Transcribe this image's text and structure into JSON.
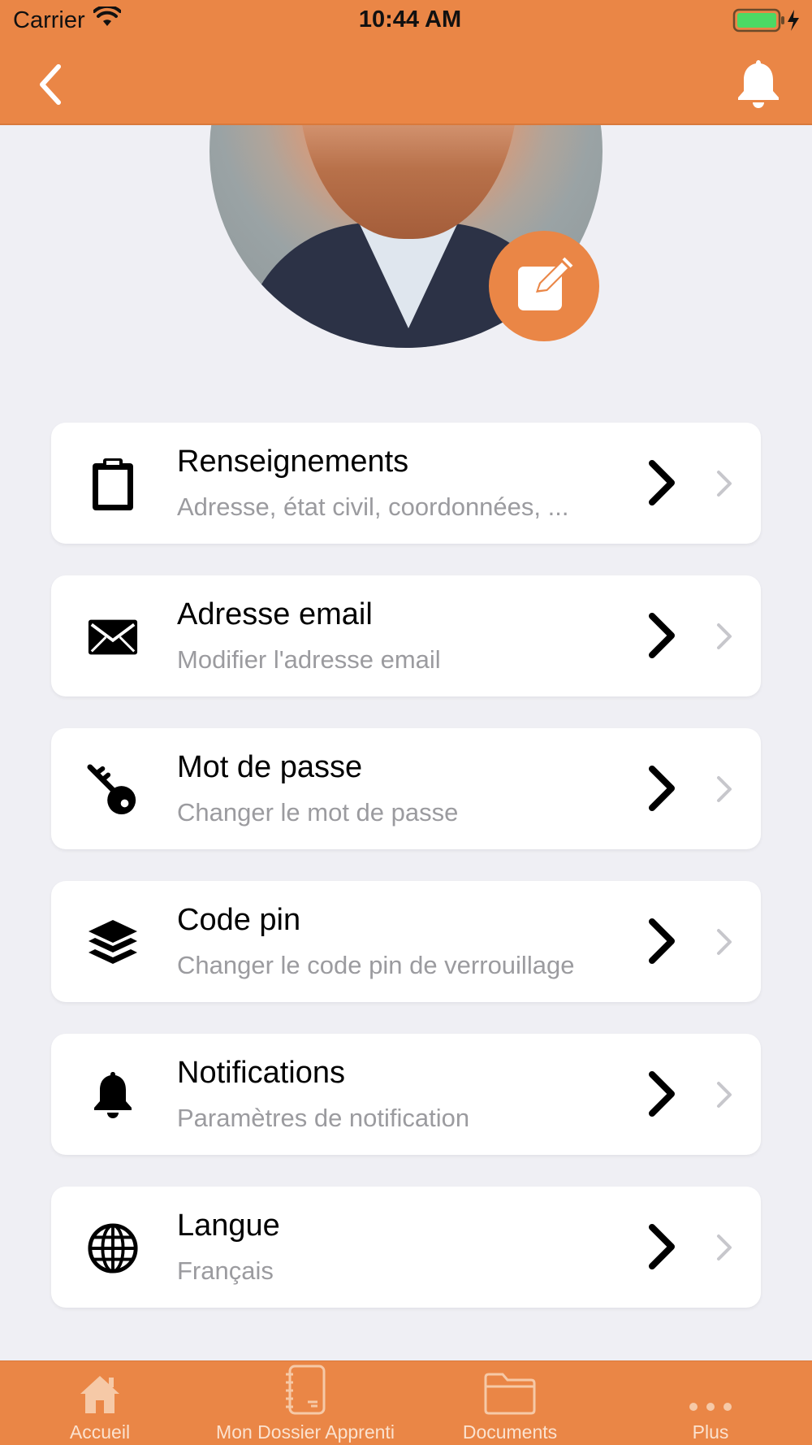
{
  "status_bar": {
    "carrier": "Carrier",
    "time": "10:44 AM",
    "wifi_icon": "wifi-icon",
    "battery_icon": "battery-charging-icon"
  },
  "nav": {
    "back_icon": "chevron-left-icon",
    "bell_icon": "bell-icon"
  },
  "profile": {
    "edit_icon": "edit-pencil-icon"
  },
  "colors": {
    "accent": "#ea8646",
    "background": "#efeff4",
    "subtitle": "#9b9b9f"
  },
  "menu": {
    "items": [
      {
        "icon": "clipboard-icon",
        "title": "Renseignements",
        "subtitle": "Adresse, état civil, coordonnées, ..."
      },
      {
        "icon": "envelope-icon",
        "title": "Adresse email",
        "subtitle": "Modifier l'adresse email"
      },
      {
        "icon": "key-icon",
        "title": "Mot de passe",
        "subtitle": "Changer le mot de passe"
      },
      {
        "icon": "layers-icon",
        "title": "Code pin",
        "subtitle": "Changer le code pin de verrouillage"
      },
      {
        "icon": "bell-icon",
        "title": "Notifications",
        "subtitle": "Paramètres de notification"
      },
      {
        "icon": "globe-icon",
        "title": "Langue",
        "subtitle": "Français"
      }
    ]
  },
  "tabbar": {
    "tabs": [
      {
        "icon": "home-icon",
        "label": "Accueil"
      },
      {
        "icon": "notebook-icon",
        "label": "Mon Dossier Apprenti"
      },
      {
        "icon": "folder-icon",
        "label": "Documents"
      },
      {
        "icon": "more-dots-icon",
        "label": "Plus"
      }
    ]
  }
}
